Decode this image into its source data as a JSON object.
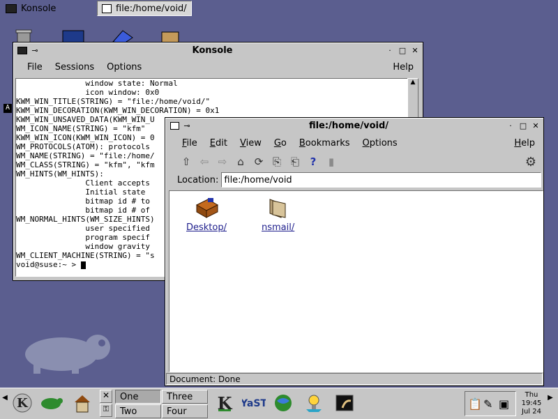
{
  "taskbar": {
    "tasks": [
      {
        "label": "Konsole"
      },
      {
        "label": "file:/home/void/"
      }
    ]
  },
  "konsole": {
    "title": "Konsole",
    "menu": [
      "File",
      "Sessions",
      "Options"
    ],
    "help": "Help",
    "lines": [
      "               window state: Normal",
      "               icon window: 0x0",
      "KWM_WIN_TITLE(STRING) = \"file:/home/void/\"",
      "KWM_WIN_DECORATION(KWM_WIN_DECORATION) = 0x1",
      "KWM_WIN_UNSAVED_DATA(KWM_WIN_U",
      "WM_ICON_NAME(STRING) = \"kfm\"",
      "KWM_WIN_ICON(KWM_WIN_ICON) = 0",
      "WM_PROTOCOLS(ATOM): protocols",
      "WM_NAME(STRING) = \"file:/home/",
      "WM_CLASS(STRING) = \"kfm\", \"kfm",
      "WM_HINTS(WM_HINTS):",
      "               Client accepts",
      "               Initial state",
      "               bitmap id # to",
      "               bitmap id # of",
      "WM_NORMAL_HINTS(WM_SIZE_HINTS)",
      "               user specified",
      "               program specif",
      "               window gravity",
      "WM_CLIENT_MACHINE(STRING) = \"s",
      "void@suse:~ > "
    ],
    "side_marker": "A"
  },
  "filemanager": {
    "title": "file:/home/void/",
    "menu": [
      {
        "label": "File",
        "u": "F",
        "rest": "ile"
      },
      {
        "label": "Edit",
        "u": "E",
        "rest": "dit"
      },
      {
        "label": "View",
        "u": "V",
        "rest": "iew"
      },
      {
        "label": "Go",
        "u": "G",
        "rest": "o"
      },
      {
        "label": "Bookmarks",
        "u": "B",
        "rest": "ookmarks"
      },
      {
        "label": "Options",
        "u": "O",
        "rest": "ptions"
      }
    ],
    "help_u": "H",
    "help_rest": "elp",
    "location_label": "Location:",
    "location_value": "file:/home/void",
    "items": [
      {
        "label": "Desktop/",
        "icon": "desktop-folder-icon"
      },
      {
        "label": "nsmail/",
        "icon": "folder-icon"
      }
    ],
    "status": "Document: Done"
  },
  "panel": {
    "pager": [
      "One",
      "Two",
      "Three",
      "Four"
    ],
    "active_desktop": "One",
    "clock": {
      "day": "Thu",
      "time": "19:45",
      "date": "Jul 24"
    }
  },
  "colors": {
    "desktop": "#5b5e8f",
    "chrome": "#c6c6c6",
    "link": "#1e1e8c"
  }
}
